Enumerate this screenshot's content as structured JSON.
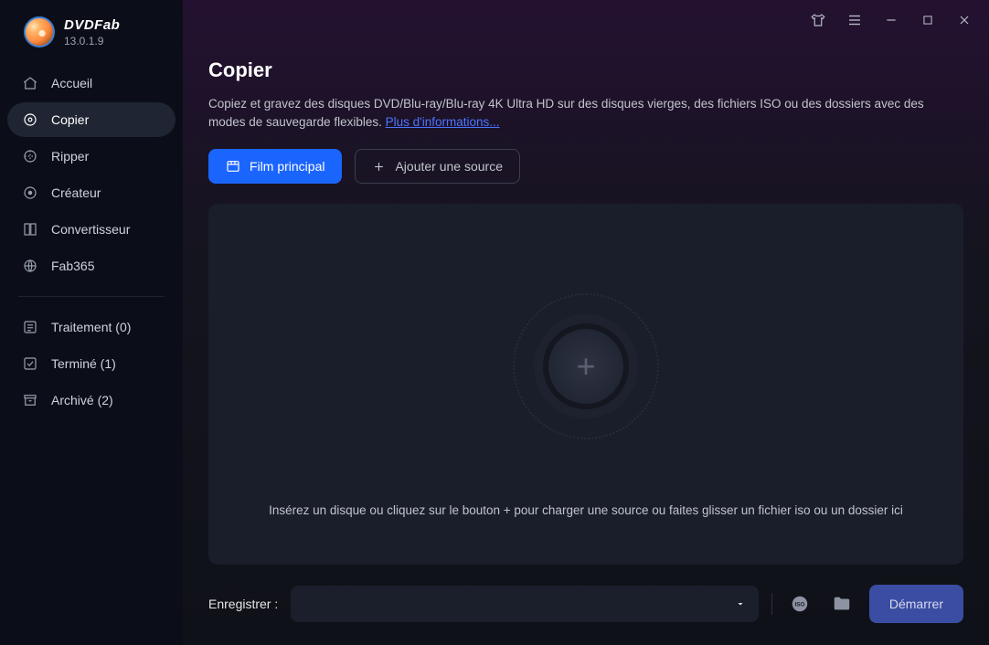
{
  "app": {
    "name": "DVDFab",
    "version": "13.0.1.9"
  },
  "sidebar": {
    "items": [
      {
        "label": "Accueil",
        "slug": "accueil",
        "icon": "home"
      },
      {
        "label": "Copier",
        "slug": "copier",
        "icon": "disc",
        "active": true
      },
      {
        "label": "Ripper",
        "slug": "ripper",
        "icon": "rip"
      },
      {
        "label": "Créateur",
        "slug": "createur",
        "icon": "creator"
      },
      {
        "label": "Convertisseur",
        "slug": "convertisseur",
        "icon": "convert"
      },
      {
        "label": "Fab365",
        "slug": "fab365",
        "icon": "globe"
      }
    ],
    "tasks": [
      {
        "label": "Traitement (0)",
        "slug": "traitement",
        "icon": "list"
      },
      {
        "label": "Terminé (1)",
        "slug": "termine",
        "icon": "check"
      },
      {
        "label": "Archivé (2)",
        "slug": "archive",
        "icon": "archive"
      }
    ]
  },
  "page": {
    "title": "Copier",
    "description": "Copiez et gravez des disques DVD/Blu-ray/Blu-ray 4K Ultra HD sur des disques vierges, des fichiers ISO ou des dossiers avec des modes de sauvegarde flexibles. ",
    "more_info": "Plus d'informations...",
    "btn_main_movie": "Film principal",
    "btn_add_source": "Ajouter une source",
    "drop_hint": "Insérez un disque ou cliquez sur le bouton +  pour charger une source ou faites glisser un fichier iso ou un dossier ici"
  },
  "footer": {
    "save_label": "Enregistrer :",
    "start_label": "Démarrer"
  }
}
